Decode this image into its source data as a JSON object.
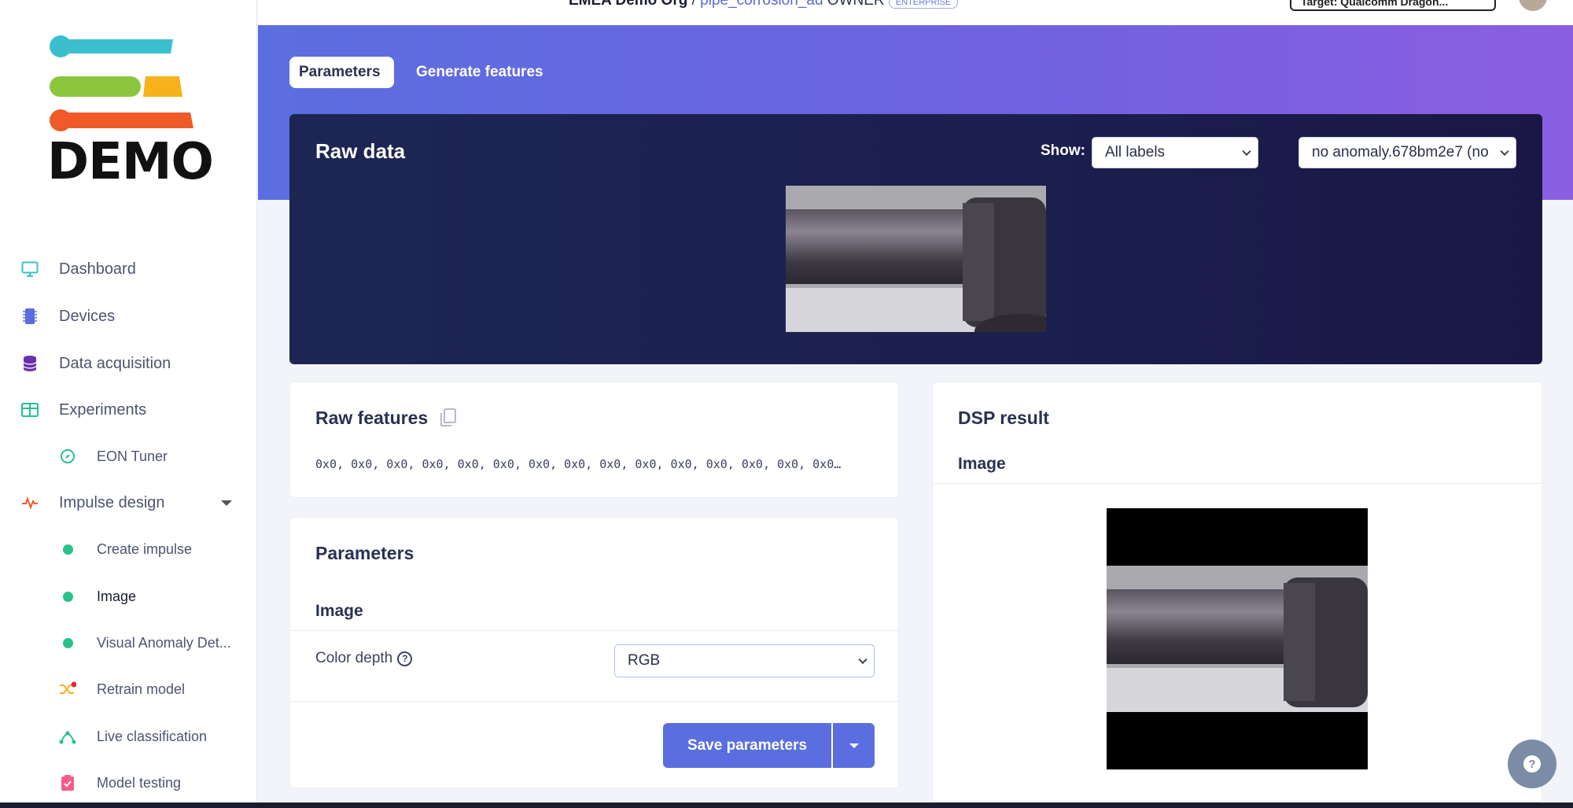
{
  "header": {
    "org": "EMEA Demo Org",
    "separator": "/",
    "project": "pipe_corrosion_ad",
    "owner": "OWNER",
    "badge": "ENTERPRISE",
    "target": "Target: Qualcomm Dragon..."
  },
  "logo": {
    "text": "DEMO"
  },
  "sidebar": {
    "items": [
      {
        "label": "Dashboard",
        "icon": "monitor-icon"
      },
      {
        "label": "Devices",
        "icon": "chip-icon"
      },
      {
        "label": "Data acquisition",
        "icon": "database-icon"
      },
      {
        "label": "Experiments",
        "icon": "table-icon"
      },
      {
        "label": "EON Tuner",
        "icon": "compass-icon"
      },
      {
        "label": "Impulse design",
        "icon": "pulse-icon"
      },
      {
        "label": "Create impulse",
        "icon": "dot-icon"
      },
      {
        "label": "Image",
        "icon": "dot-icon"
      },
      {
        "label": "Visual Anomaly Det...",
        "icon": "dot-icon"
      },
      {
        "label": "Retrain model",
        "icon": "shuffle-icon"
      },
      {
        "label": "Live classification",
        "icon": "network-icon"
      },
      {
        "label": "Model testing",
        "icon": "clipboard-check-icon"
      }
    ]
  },
  "tabs": {
    "parameters": "Parameters",
    "generate": "Generate features"
  },
  "raw_data": {
    "title": "Raw data",
    "show_label": "Show:",
    "show_value": "All labels",
    "sample_value": "no anomaly.678bm2e7 (no"
  },
  "raw_features": {
    "title": "Raw features",
    "values": "0x0, 0x0, 0x0, 0x0, 0x0, 0x0, 0x0, 0x0, 0x0, 0x0, 0x0, 0x0, 0x0, 0x0, 0x0…"
  },
  "parameters": {
    "title": "Parameters",
    "section": "Image",
    "color_depth_label": "Color depth",
    "color_depth_value": "RGB",
    "save_label": "Save parameters"
  },
  "dsp": {
    "title": "DSP result",
    "section": "Image"
  },
  "colors": {
    "accent": "#5a6ee0",
    "navy": "#1d2653",
    "green": "#27c28a"
  }
}
